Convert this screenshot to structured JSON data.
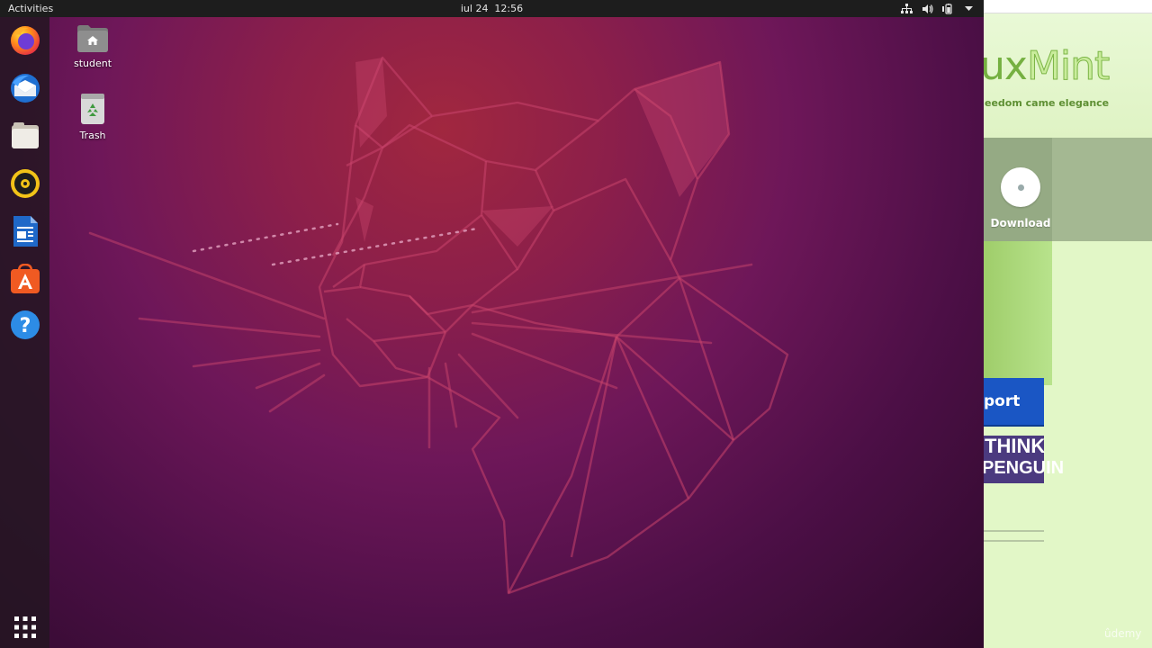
{
  "topbar": {
    "activities": "Activities",
    "clock": "iul 24  12:56",
    "tray_icons": [
      "network-icon",
      "volume-icon",
      "battery-icon",
      "system-menu-chevron-icon"
    ]
  },
  "dock": {
    "items": [
      {
        "name": "firefox",
        "icon": "firefox-icon"
      },
      {
        "name": "thunderbird",
        "icon": "thunderbird-icon"
      },
      {
        "name": "files",
        "icon": "files-icon"
      },
      {
        "name": "rhythmbox",
        "icon": "rhythmbox-icon"
      },
      {
        "name": "libreoffice-writer",
        "icon": "writer-icon"
      },
      {
        "name": "ubuntu-software",
        "icon": "software-center-icon"
      },
      {
        "name": "help",
        "icon": "help-icon"
      }
    ],
    "show_apps": "show-applications-icon"
  },
  "desktop": {
    "icons": [
      {
        "label": "student",
        "icon": "home-folder-icon"
      },
      {
        "label": "Trash",
        "icon": "trash-icon"
      }
    ]
  },
  "host_page": {
    "logo_text_a": "ux",
    "logo_text_b": "Mint",
    "tagline": "eedom came elegance",
    "download_label": "Download",
    "support_label": "port",
    "think_line1": "THINK",
    "think_line2": "PENGUIN"
  },
  "watermark": "ûdemy",
  "colors": {
    "topbar": "#1d1d1d",
    "wallpaper_top": "#a1273f",
    "wallpaper_bottom": "#2e0a2b",
    "mint_green": "#75b041",
    "support_blue": "#1a56c4",
    "think_purple": "#4b3a7f"
  }
}
